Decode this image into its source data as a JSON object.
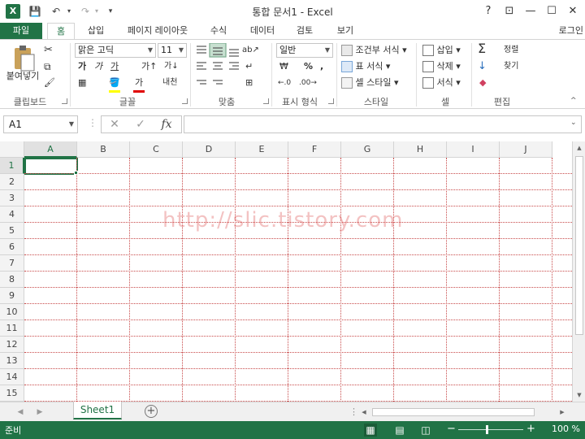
{
  "app": {
    "title": "통합 문서1 - Excel",
    "logo": "X",
    "login": "로그인"
  },
  "qat": {
    "save_icon": "💾",
    "undo_icon": "↶",
    "redo_icon": "↷",
    "customize_icon": "▾"
  },
  "window": {
    "help": "?",
    "restore_ribbon": "⊡",
    "minimize": "—",
    "maximize": "☐",
    "close": "✕"
  },
  "tabs": [
    {
      "label": "파일"
    },
    {
      "label": "홈"
    },
    {
      "label": "삽입"
    },
    {
      "label": "페이지 레이아웃"
    },
    {
      "label": "수식"
    },
    {
      "label": "데이터"
    },
    {
      "label": "검토"
    },
    {
      "label": "보기"
    }
  ],
  "ribbon": {
    "clipboard": {
      "label": "클립보드",
      "paste": "붙여넣기",
      "cut_icon": "✂",
      "copy_icon": "⧉",
      "format_painter_icon": "🖌"
    },
    "font": {
      "label": "글꼴",
      "font_name": "맑은 고딕",
      "font_size": "11",
      "bold": "가",
      "italic": "가",
      "underline": "가",
      "grow": "가↑",
      "shrink": "가↓",
      "fill_icon": "🪣",
      "font_color": "가",
      "phonetic": "내천",
      "borders_icon": "▦"
    },
    "alignment": {
      "label": "맞춤",
      "wrap_icon": "↵",
      "merge_icon": "⊞",
      "orient_icon": "ab↗"
    },
    "number": {
      "label": "표시 형식",
      "format": "일반",
      "currency": "₩",
      "percent": "%",
      "comma": ",",
      "inc_dec": "←.0",
      "dec_dec": ".00→"
    },
    "styles": {
      "label": "스타일",
      "conditional": "조건부 서식",
      "table": "표 서식",
      "cell_styles": "셀 스타일"
    },
    "cells": {
      "label": "셀",
      "insert": "삽입",
      "delete": "삭제",
      "format": "서식"
    },
    "editing": {
      "label": "편집",
      "sum": "Σ",
      "fill": "↓",
      "clear": "◆",
      "sort": "정렬",
      "find": "찾기"
    }
  },
  "formula_bar": {
    "name_box": "A1",
    "cancel": "✕",
    "enter": "✓",
    "fx": "fx",
    "value": ""
  },
  "columns": [
    "A",
    "B",
    "C",
    "D",
    "E",
    "F",
    "G",
    "H",
    "I",
    "J"
  ],
  "rows": [
    "1",
    "2",
    "3",
    "4",
    "5",
    "6",
    "7",
    "8",
    "9",
    "10",
    "11",
    "12",
    "13",
    "14",
    "15"
  ],
  "watermark": "http://slic.tistory.com",
  "sheets": [
    {
      "label": "Sheet1"
    }
  ],
  "add_sheet": "+",
  "status": {
    "text": "준비",
    "zoom": "100 %",
    "zoom_level": 100,
    "zoom_out": "−",
    "zoom_in": "+"
  },
  "colors": {
    "accent": "#217346",
    "gridline": "#c84a4a"
  }
}
